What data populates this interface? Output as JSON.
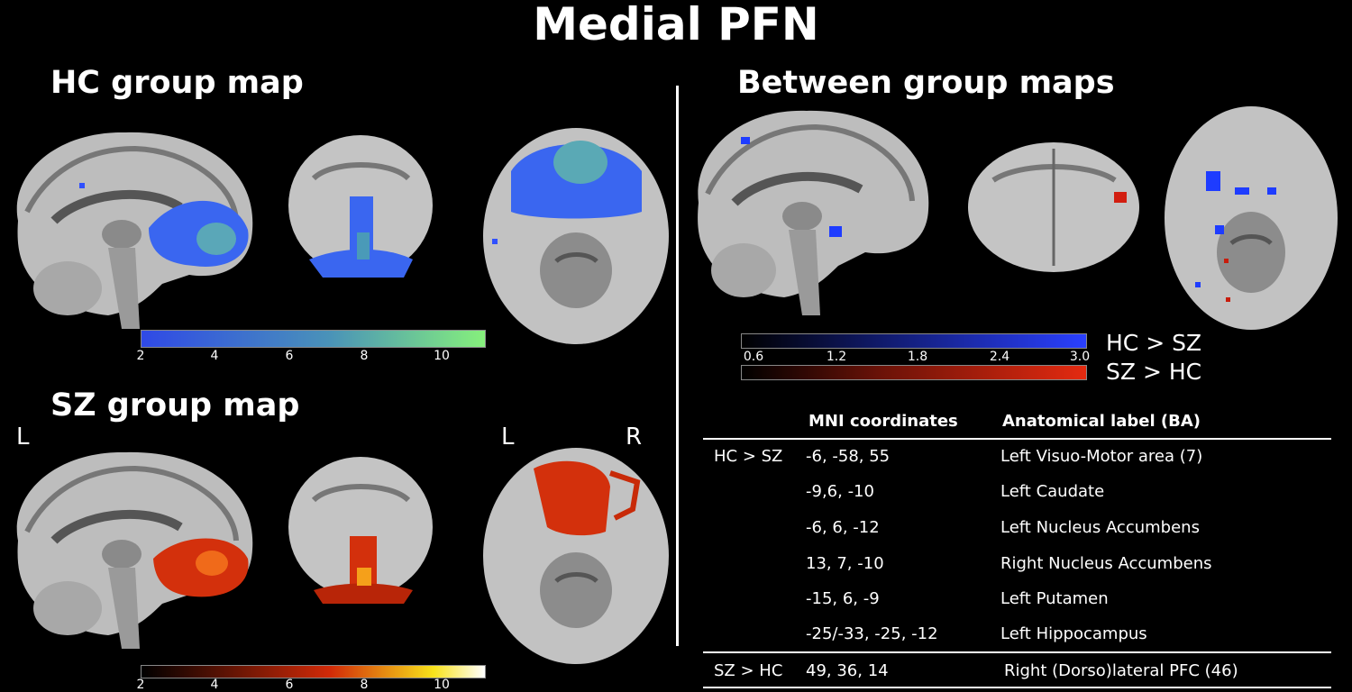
{
  "title": "Medial PFN",
  "panels": {
    "hc": {
      "title": "HC group map",
      "colorbar_ticks": [
        "2",
        "4",
        "6",
        "8",
        "10"
      ],
      "colorbar": {
        "low": "#2f49e6",
        "mid": "#4a93b8",
        "high": "#86f07c"
      }
    },
    "sz": {
      "title": "SZ group map",
      "colorbar_ticks": [
        "2",
        "4",
        "6",
        "8",
        "10"
      ],
      "colorbar": {
        "low": "#000000",
        "mid": "#d12a08",
        "high": "#ffffff"
      }
    },
    "between": {
      "title": "Between group maps",
      "colorbar_ticks": [
        "0.6",
        "1.2",
        "1.8",
        "2.4",
        "3.0"
      ],
      "blue_label": "HC > SZ",
      "red_label": "SZ > HC"
    }
  },
  "orientation": {
    "left": "L",
    "axial_left": "L",
    "axial_right": "R"
  },
  "table": {
    "headers": [
      "",
      "MNI coordinates",
      "Anatomical label (BA)"
    ],
    "rows": [
      {
        "group": "HC > SZ",
        "coords": "-6, -58, 55",
        "label": "Left Visuo-Motor area (7)"
      },
      {
        "group": "",
        "coords": "-9,6, -10",
        "label": "Left Caudate"
      },
      {
        "group": "",
        "coords": "-6, 6, -12",
        "label": "Left Nucleus Accumbens"
      },
      {
        "group": "",
        "coords": "13, 7, -10",
        "label": "Right Nucleus Accumbens"
      },
      {
        "group": "",
        "coords": "-15, 6, -9",
        "label": "Left Putamen"
      },
      {
        "group": "",
        "coords": "-25/-33, -25, -12",
        "label": "Left Hippocampus"
      },
      {
        "group": "SZ > HC",
        "coords": "49, 36, 14",
        "label": "Right (Dorso)lateral PFC (46)"
      }
    ]
  }
}
